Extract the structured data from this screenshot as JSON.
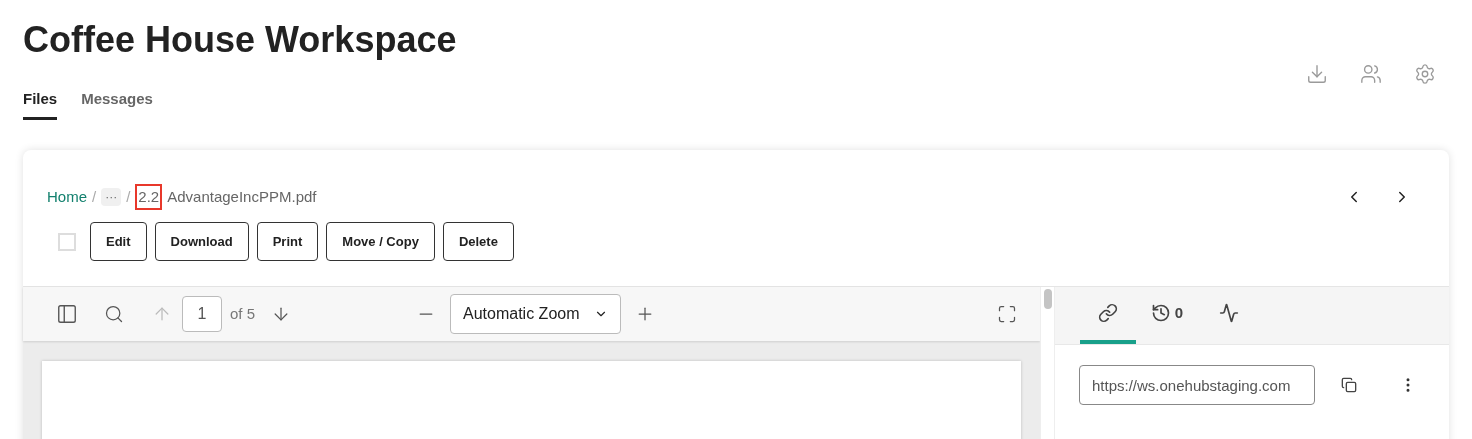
{
  "title": "Coffee House Workspace",
  "tabs": [
    {
      "label": "Files",
      "selected": true
    },
    {
      "label": "Messages",
      "selected": false
    }
  ],
  "breadcrumb": {
    "home": "Home",
    "separators": [
      "/",
      "/"
    ],
    "ellipsis": "···",
    "version": "2.2",
    "version_highlighted": true,
    "file": "AdvantageIncPPM.pdf"
  },
  "select_all": {
    "checked": false
  },
  "actions": [
    "Edit",
    "Download",
    "Print",
    "Move / Copy",
    "Delete"
  ],
  "viewer": {
    "page": "1",
    "page_count": "of 5",
    "zoom": "Automatic Zoom"
  },
  "side_tabs": [
    {
      "kind": "link",
      "selected": true
    },
    {
      "kind": "history",
      "count": "0",
      "selected": false
    },
    {
      "kind": "activity",
      "selected": false
    }
  ],
  "share_link": {
    "value": "https://ws.onehubstaging.com"
  }
}
